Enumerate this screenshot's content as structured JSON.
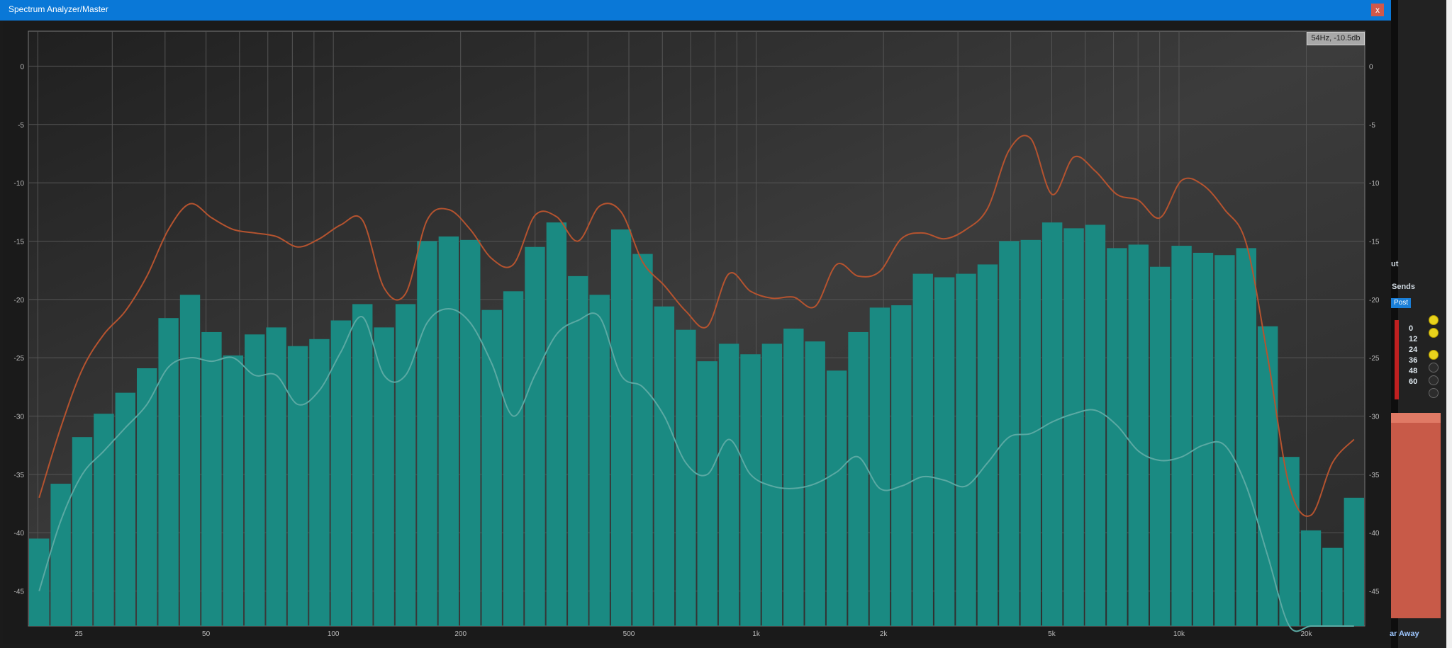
{
  "window": {
    "title": "Spectrum Analyzer/Master",
    "close_label": "x"
  },
  "readout": "54Hz, -10.5db",
  "chart_data": {
    "type": "bar",
    "title": "",
    "xlabel": "",
    "ylabel": "",
    "x_scale": "log",
    "x_ticks": [
      {
        "label": "25",
        "hz": 25
      },
      {
        "label": "50",
        "hz": 50
      },
      {
        "label": "100",
        "hz": 100
      },
      {
        "label": "200",
        "hz": 200
      },
      {
        "label": "500",
        "hz": 500
      },
      {
        "label": "1k",
        "hz": 1000
      },
      {
        "label": "2k",
        "hz": 2000
      },
      {
        "label": "5k",
        "hz": 5000
      },
      {
        "label": "10k",
        "hz": 10000
      },
      {
        "label": "20k",
        "hz": 20000
      }
    ],
    "y_ticks": [
      "0",
      "-5",
      "-10",
      "-15",
      "-20",
      "-25",
      "-30",
      "-35",
      "-40",
      "-45"
    ],
    "ylim": [
      -48,
      3
    ],
    "grid": true,
    "series": [
      {
        "kind": "bars",
        "color": "#1a8a82",
        "values": [
          -40.5,
          -35.8,
          -31.8,
          -29.8,
          -28.0,
          -25.9,
          -21.6,
          -19.6,
          -22.8,
          -24.8,
          -23.0,
          -22.4,
          -24.0,
          -23.4,
          -21.8,
          -20.4,
          -22.4,
          -20.4,
          -15.0,
          -14.6,
          -14.9,
          -20.9,
          -19.3,
          -15.5,
          -13.4,
          -18.0,
          -19.6,
          -14.0,
          -16.1,
          -20.6,
          -22.6,
          -25.3,
          -23.8,
          -24.7,
          -23.8,
          -22.5,
          -23.6,
          -26.1,
          -22.8,
          -20.7,
          -20.5,
          -17.8,
          -18.1,
          -17.8,
          -17.0,
          -15.0,
          -14.9,
          -13.4,
          -13.9,
          -13.6,
          -15.6,
          -15.3,
          -17.2,
          -15.4,
          -16.0,
          -16.2,
          -15.6,
          -22.3,
          -33.5,
          -39.8,
          -41.3,
          -37.0
        ]
      },
      {
        "kind": "line",
        "color": "#b5532f",
        "name": "",
        "values": [
          -37.0,
          -31.0,
          -26.0,
          -23.0,
          -21.0,
          -18.0,
          -14.0,
          -11.8,
          -13.0,
          -14.0,
          -14.3,
          -14.6,
          -15.5,
          -14.8,
          -13.6,
          -13.2,
          -19.0,
          -19.5,
          -13.2,
          -12.3,
          -14.0,
          -16.5,
          -17.0,
          -12.8,
          -12.9,
          -15.0,
          -12.0,
          -12.5,
          -16.8,
          -18.8,
          -21.0,
          -22.3,
          -17.8,
          -19.3,
          -19.9,
          -19.8,
          -20.6,
          -17.0,
          -18.0,
          -17.6,
          -14.8,
          -14.3,
          -14.8,
          -14.0,
          -12.2,
          -7.2,
          -6.2,
          -11.0,
          -7.8,
          -9.0,
          -11.0,
          -11.5,
          -13.0,
          -9.8,
          -10.2,
          -12.3,
          -15.2,
          -25.0,
          -36.0,
          -38.5,
          -34.0,
          -32.0
        ]
      },
      {
        "kind": "line",
        "color": "#5aa9a3",
        "name": "",
        "values": [
          -45.0,
          -39.0,
          -35.0,
          -33.0,
          -31.0,
          -29.0,
          -25.8,
          -25.0,
          -25.3,
          -25.0,
          -26.5,
          -26.5,
          -29.0,
          -27.8,
          -24.5,
          -21.5,
          -26.5,
          -26.5,
          -22.0,
          -20.8,
          -22.0,
          -25.5,
          -30.0,
          -26.5,
          -23.0,
          -21.8,
          -21.5,
          -26.5,
          -27.5,
          -30.0,
          -34.0,
          -35.0,
          -32.0,
          -35.0,
          -36.0,
          -36.2,
          -35.8,
          -34.8,
          -33.5,
          -36.2,
          -36.0,
          -35.2,
          -35.5,
          -36.0,
          -34.0,
          -31.8,
          -31.5,
          -30.5,
          -29.8,
          -29.5,
          -30.8,
          -33.0,
          -33.8,
          -33.5,
          -32.5,
          -32.5,
          -36.0,
          -42.0,
          -48.0,
          -48.0,
          -48.0,
          -48.0
        ]
      }
    ]
  },
  "sidepanel": {
    "sends_label": "Sends",
    "post_label": "Post",
    "out_label": "ut",
    "meter_scale": [
      "0",
      "12",
      "24",
      "36",
      "48",
      "60"
    ],
    "bottom_label": "ar Away"
  }
}
